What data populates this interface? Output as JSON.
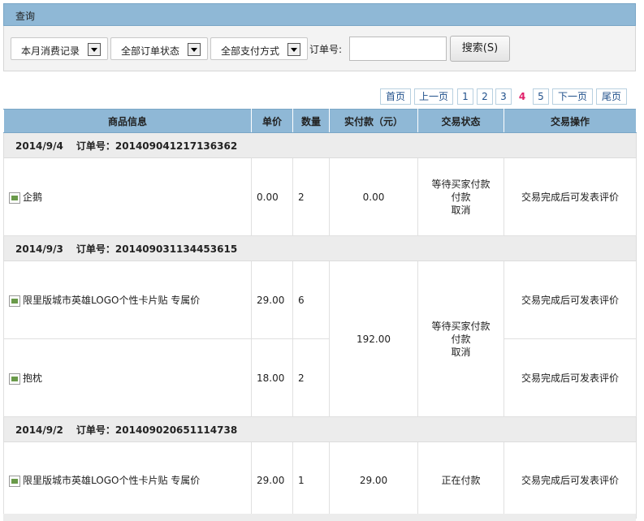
{
  "header": {
    "title": "查询"
  },
  "filters": {
    "period": "本月消费记录",
    "order_status": "全部订单状态",
    "pay_method": "全部支付方式",
    "order_no_label": "订单号:",
    "order_no_value": "",
    "search_label": "搜索(S)"
  },
  "pagination": {
    "first": "首页",
    "prev": "上一页",
    "pages": [
      "1",
      "2",
      "3",
      "4",
      "5"
    ],
    "current": "4",
    "next": "下一页",
    "last": "尾页"
  },
  "table": {
    "headers": [
      "商品信息",
      "单价",
      "数量",
      "实付款（元）",
      "交易状态",
      "交易操作"
    ],
    "order_no_prefix": "订单号：",
    "orders": [
      {
        "date": "2014/9/4",
        "order_no": "201409041217136362",
        "total": "0.00",
        "status": [
          "等待买家付款",
          "付款",
          "取消"
        ],
        "items": [
          {
            "name": "企鹅",
            "price": "0.00",
            "qty": "2",
            "action": "交易完成后可发表评价"
          }
        ]
      },
      {
        "date": "2014/9/3",
        "order_no": "201409031134453615",
        "total": "192.00",
        "status": [
          "等待买家付款",
          "付款",
          "取消"
        ],
        "items": [
          {
            "name": "限里版城市英雄LOGO个性卡片贴 专属价",
            "price": "29.00",
            "qty": "6",
            "action": "交易完成后可发表评价"
          },
          {
            "name": "抱枕",
            "price": "18.00",
            "qty": "2",
            "action": "交易完成后可发表评价"
          }
        ]
      },
      {
        "date": "2014/9/2",
        "order_no": "201409020651114738",
        "total": "29.00",
        "status": [
          "正在付款"
        ],
        "items": [
          {
            "name": "限里版城市英雄LOGO个性卡片贴 专属价",
            "price": "29.00",
            "qty": "1",
            "action": "交易完成后可发表评价"
          }
        ]
      }
    ]
  }
}
